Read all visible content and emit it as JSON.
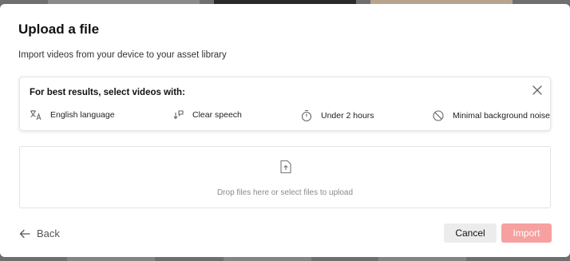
{
  "dialog": {
    "title": "Upload a file",
    "subtitle": "Import videos from your device to your asset library"
  },
  "tips": {
    "heading": "For best results, select videos with:",
    "items": [
      {
        "label": "English language",
        "icon": "translate-icon"
      },
      {
        "label": "Clear speech",
        "icon": "speech-icon"
      },
      {
        "label": "Under 2 hours",
        "icon": "timer-icon"
      },
      {
        "label": "Minimal background noise",
        "icon": "no-noise-icon"
      }
    ],
    "close_icon": "close-icon"
  },
  "dropzone": {
    "text": "Drop files here or select files to upload",
    "icon": "file-upload-icon"
  },
  "footer": {
    "back_label": "Back",
    "cancel_label": "Cancel",
    "import_label": "Import"
  },
  "colors": {
    "import_button_bg": "#f6a0a0",
    "cancel_button_bg": "#ececec"
  }
}
